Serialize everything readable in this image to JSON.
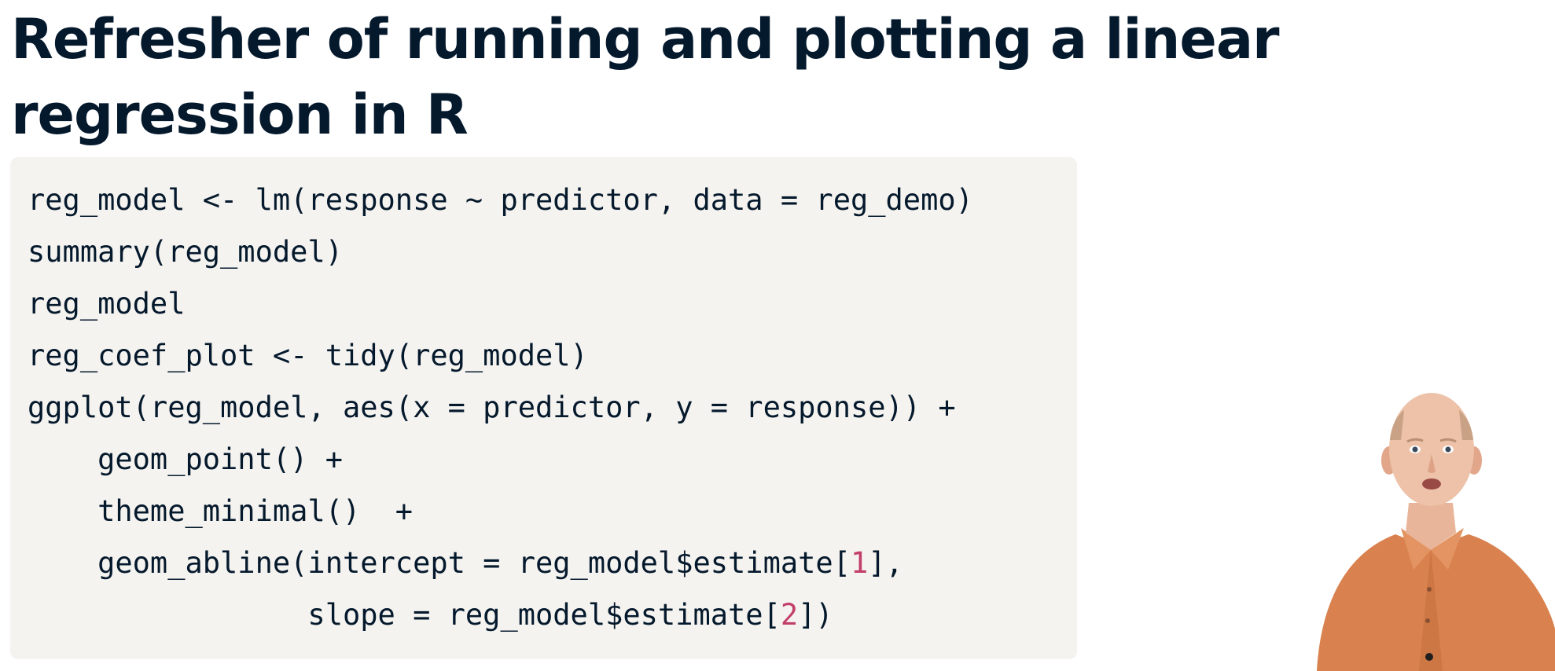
{
  "slide": {
    "title": "Refresher of running and plotting a linear regression in R"
  },
  "code": {
    "line1": "reg_model <- lm(response ~ predictor, data = reg_demo)",
    "line2": "summary(reg_model)",
    "line3": "reg_model",
    "line4": "reg_coef_plot <- tidy(reg_model)",
    "line5": "ggplot(reg_model, aes(x = predictor, y = response)) +",
    "line6": "    geom_point() +",
    "line7": "    theme_minimal()  +",
    "line8_pre": "    geom_abline(intercept = reg_model$estimate[",
    "line8_num": "1",
    "line8_post": "],",
    "line9_pre": "                slope = reg_model$estimate[",
    "line9_num": "2",
    "line9_post": "])"
  },
  "colors": {
    "title": "#05192d",
    "code_background": "#f5f3ef",
    "code_text": "#05192d",
    "number_literal": "#c13f6a",
    "shirt": "#d9824f"
  },
  "icons": {
    "presenter": "presenter-video"
  }
}
